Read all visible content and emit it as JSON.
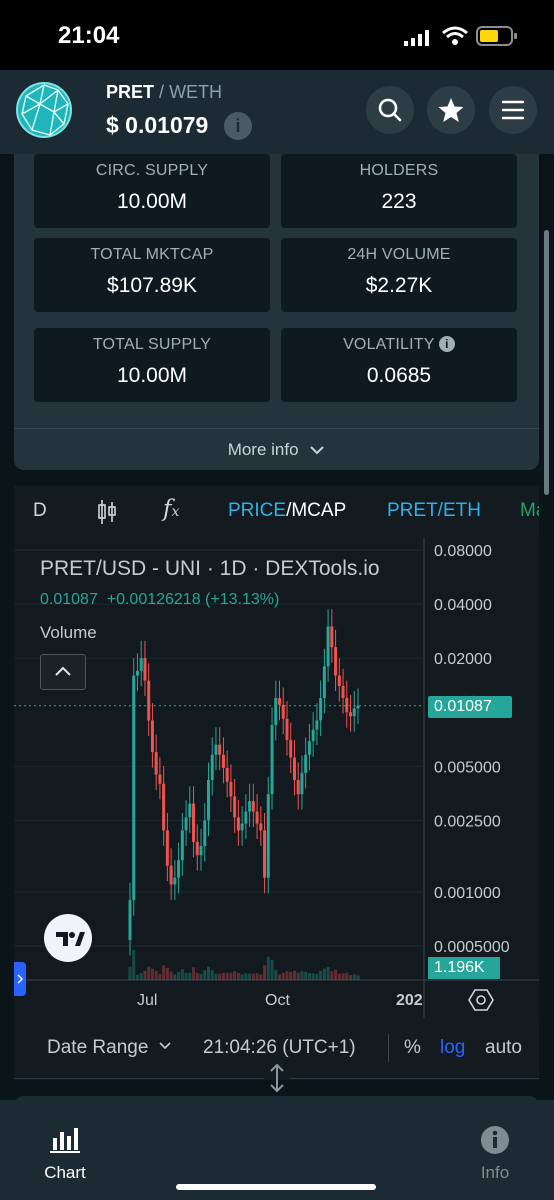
{
  "status_bar": {
    "time": "21:04"
  },
  "header": {
    "base": "PRET",
    "sep": "/",
    "quote": "WETH",
    "price": "$ 0.01079",
    "info": "i"
  },
  "stats": [
    {
      "label": "CIRC. SUPPLY",
      "value": "10.00M"
    },
    {
      "label": "HOLDERS",
      "value": "223"
    },
    {
      "label": "TOTAL MKTCAP",
      "value": "$107.89K"
    },
    {
      "label": "24H VOLUME",
      "value": "$2.27K"
    },
    {
      "label": "TOTAL SUPPLY",
      "value": "10.00M"
    },
    {
      "label": "VOLATILITY",
      "value": "0.0685"
    }
  ],
  "more_info": "More info",
  "toolbar": {
    "interval": "D",
    "fx": "f",
    "fx_sub": "x",
    "price": "PRICE",
    "slash": "/",
    "mcap": "MCAP",
    "pair": "PRET/ETH",
    "ma": "Ma"
  },
  "chart": {
    "legend_title": "PRET/USD - UNI · 1D · DEXTools.io",
    "legend_values": "0.01087  +0.00126218 (+13.13%)",
    "volume_label": "Volume",
    "price_tag": "0.01087",
    "volume_tag": "1.196K",
    "time_labels": [
      "Jul",
      "Oct",
      "202"
    ],
    "logo_text": "TV"
  },
  "chart_data": {
    "type": "candlestick",
    "title": "PRET/USD - UNI · 1D · DEXTools.io",
    "y_scale": "log",
    "y_ticks": [
      "0.08000",
      "0.04000",
      "0.02000",
      "0.01087",
      "0.005000",
      "0.002500",
      "0.001000",
      "0.0005000"
    ],
    "x_ticks": [
      "Jul",
      "Oct",
      "202"
    ],
    "last_price": 0.01087,
    "change": 0.00126218,
    "change_pct": 13.13,
    "volume": "1.196K",
    "series": [
      {
        "values": [
          0.0009,
          0.016,
          0.017,
          0.02,
          0.015,
          0.009,
          0.006,
          0.0045,
          0.004,
          0.0022,
          0.0014,
          0.0011,
          0.0012,
          0.0015,
          0.0022,
          0.0026,
          0.0031,
          0.0019,
          0.0016,
          0.0018,
          0.0025,
          0.0042,
          0.0058,
          0.0066,
          0.0058,
          0.0049,
          0.0041,
          0.0034,
          0.0026,
          0.0022,
          0.0024,
          0.0028,
          0.0032,
          0.0028,
          0.0024,
          0.0022,
          0.0012,
          0.0035,
          0.0085,
          0.012,
          0.011,
          0.0092,
          0.007,
          0.0056,
          0.0042,
          0.0035,
          0.0046,
          0.0058,
          0.0069,
          0.008,
          0.009,
          0.012,
          0.018,
          0.03,
          0.023,
          0.016,
          0.014,
          0.012,
          0.01,
          0.0095,
          0.0105,
          0.01087
        ]
      }
    ]
  },
  "chart_bottom": {
    "date_range": "Date Range",
    "clock": "21:04:26 (UTC+1)",
    "pct": "%",
    "log": "log",
    "auto": "auto"
  },
  "nav": {
    "chart": "Chart",
    "info": "Info"
  }
}
